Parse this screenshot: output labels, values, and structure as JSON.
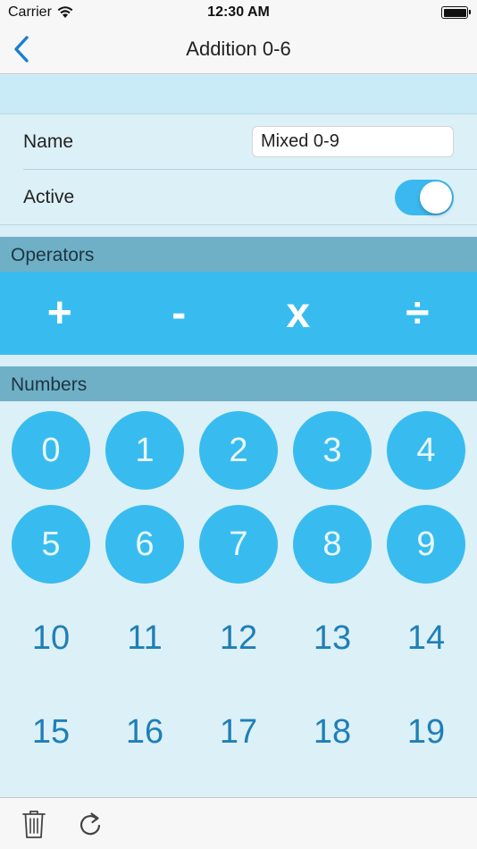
{
  "status_bar": {
    "carrier": "Carrier",
    "time": "12:30 AM"
  },
  "nav": {
    "title": "Addition 0-6"
  },
  "form": {
    "name_label": "Name",
    "name_value": "Mixed 0-9",
    "active_label": "Active",
    "active_on": true
  },
  "operators": {
    "header": "Operators",
    "items": [
      {
        "label": "+",
        "name": "plus"
      },
      {
        "label": "-",
        "name": "minus"
      },
      {
        "label": "x",
        "name": "multiply"
      },
      {
        "label": "÷",
        "name": "divide"
      }
    ]
  },
  "numbers": {
    "header": "Numbers",
    "items": [
      {
        "label": "0",
        "selected": true
      },
      {
        "label": "1",
        "selected": true
      },
      {
        "label": "2",
        "selected": true
      },
      {
        "label": "3",
        "selected": true
      },
      {
        "label": "4",
        "selected": true
      },
      {
        "label": "5",
        "selected": true
      },
      {
        "label": "6",
        "selected": true
      },
      {
        "label": "7",
        "selected": true
      },
      {
        "label": "8",
        "selected": true
      },
      {
        "label": "9",
        "selected": true
      },
      {
        "label": "10",
        "selected": false
      },
      {
        "label": "11",
        "selected": false
      },
      {
        "label": "12",
        "selected": false
      },
      {
        "label": "13",
        "selected": false
      },
      {
        "label": "14",
        "selected": false
      },
      {
        "label": "15",
        "selected": false
      },
      {
        "label": "16",
        "selected": false
      },
      {
        "label": "17",
        "selected": false
      },
      {
        "label": "18",
        "selected": false
      },
      {
        "label": "19",
        "selected": false
      }
    ]
  },
  "toolbar": {
    "trash_icon": "trash-icon",
    "refresh_icon": "refresh-icon"
  },
  "colors": {
    "accent": "#38bcef",
    "section_header": "#6fb0c7",
    "number_text": "#1f7fb6"
  }
}
